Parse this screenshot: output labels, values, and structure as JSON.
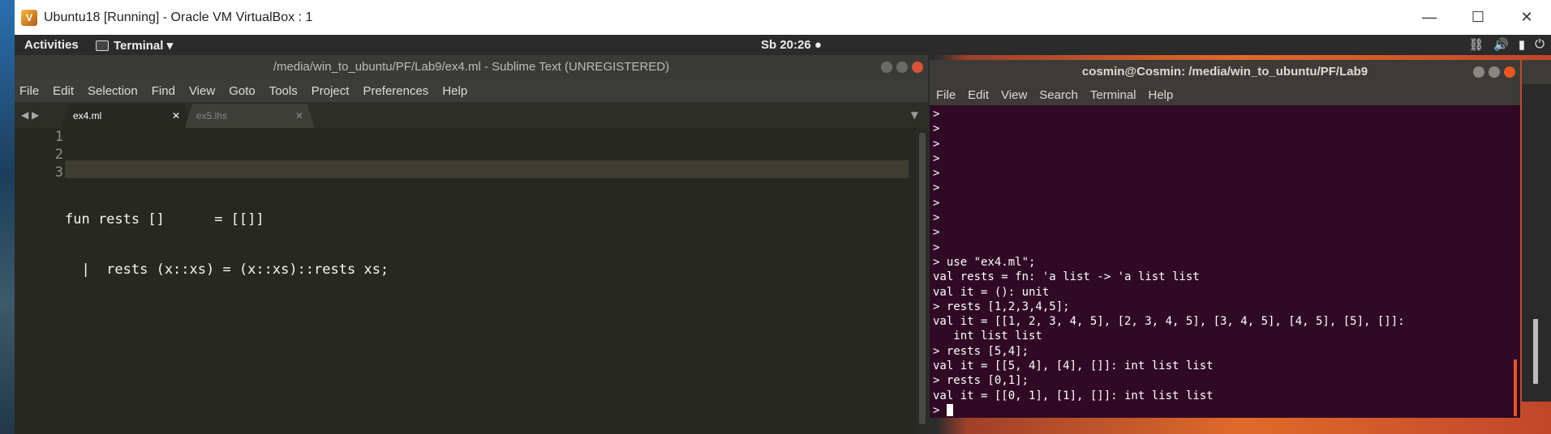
{
  "vbox": {
    "title": "Ubuntu18 [Running] - Oracle VM VirtualBox : 1",
    "controls": {
      "minimize": "—",
      "maximize": "☐",
      "close": "✕"
    }
  },
  "topbar": {
    "activities": "Activities",
    "app_menu": "Terminal ▾",
    "clock": "Sb 20:26 ●",
    "tray": [
      "network-icon",
      "volume-icon",
      "battery-icon",
      "power-icon"
    ]
  },
  "sublime": {
    "title": "/media/win_to_ubuntu/PF/Lab9/ex4.ml - Sublime Text (UNREGISTERED)",
    "menu": [
      "File",
      "Edit",
      "Selection",
      "Find",
      "View",
      "Goto",
      "Tools",
      "Project",
      "Preferences",
      "Help"
    ],
    "tabs": [
      {
        "label": "ex4.ml",
        "active": true
      },
      {
        "label": "ex5.lhs",
        "active": false
      }
    ],
    "lines": [
      {
        "num": "1",
        "code": ""
      },
      {
        "num": "2",
        "code": "fun rests []      = [[]]"
      },
      {
        "num": "3",
        "code": "  |  rests (x::xs) = (x::xs)::rests xs;"
      }
    ]
  },
  "terminal": {
    "title": "cosmin@Cosmin: /media/win_to_ubuntu/PF/Lab9",
    "menu": [
      "File",
      "Edit",
      "View",
      "Search",
      "Terminal",
      "Help"
    ],
    "lines": [
      ">",
      ">",
      ">",
      ">",
      ">",
      ">",
      ">",
      ">",
      ">",
      ">",
      "> use \"ex4.ml\";",
      "val rests = fn: 'a list -> 'a list list",
      "val it = (): unit",
      "> rests [1,2,3,4,5];",
      "val it = [[1, 2, 3, 4, 5], [2, 3, 4, 5], [3, 4, 5], [4, 5], [5], []]:",
      "   int list list",
      "> rests [5,4];",
      "val it = [[5, 4], [4], []]: int list list",
      "> rests [0,1];",
      "val it = [[0, 1], [1], []]: int list list"
    ],
    "prompt": "> "
  }
}
